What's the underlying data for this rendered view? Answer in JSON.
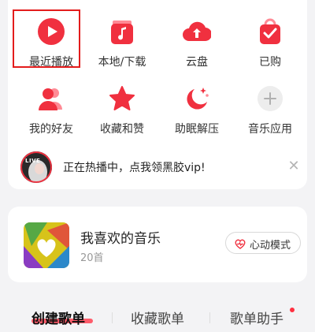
{
  "quick_grid": [
    {
      "label": "最近播放",
      "icon": "play-icon"
    },
    {
      "label": "本地/下载",
      "icon": "music-note-icon"
    },
    {
      "label": "云盘",
      "icon": "cloud-upload-icon"
    },
    {
      "label": "已购",
      "icon": "check-bag-icon"
    },
    {
      "label": "我的好友",
      "icon": "friends-icon"
    },
    {
      "label": "收藏和赞",
      "icon": "star-icon"
    },
    {
      "label": "助眠解压",
      "icon": "moon-icon"
    },
    {
      "label": "音乐应用",
      "icon": "plus-icon"
    }
  ],
  "banner": {
    "badge": "LIVE",
    "message": "正在热播中，点我领黑胶vip!",
    "close_icon": "close-icon"
  },
  "liked": {
    "title": "我喜欢的音乐",
    "count": "20首",
    "button_label": "心动模式"
  },
  "tabs": [
    "创建歌单",
    "收藏歌单",
    "歌单助手"
  ],
  "colors": {
    "accent": "#f0303f",
    "gray_icon": "#cfcfcf"
  }
}
